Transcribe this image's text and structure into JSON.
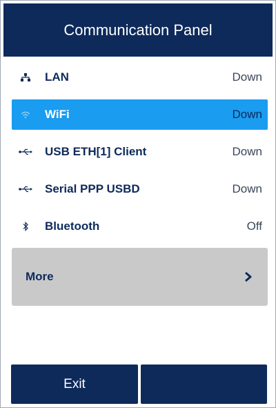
{
  "header": {
    "title": "Communication Panel"
  },
  "interfaces": [
    {
      "icon": "network-icon",
      "label": "LAN",
      "status": "Down"
    },
    {
      "icon": "wifi-icon",
      "label": "WiFi",
      "status": "Down",
      "selected": true
    },
    {
      "icon": "usb-icon",
      "label": "USB ETH[1] Client",
      "status": "Down"
    },
    {
      "icon": "usb-icon",
      "label": "Serial PPP USBD",
      "status": "Down"
    },
    {
      "icon": "bluetooth-icon",
      "label": "Bluetooth",
      "status": "Off"
    }
  ],
  "more": {
    "label": "More",
    "icon": "chevron-right-icon"
  },
  "footer": {
    "exit_label": "Exit",
    "second_label": ""
  },
  "colors": {
    "header_bg": "#0d2a5a",
    "selected_bg": "#1a9cf0",
    "more_bg": "#c9c9c9",
    "text_primary": "#0d2a5a"
  }
}
